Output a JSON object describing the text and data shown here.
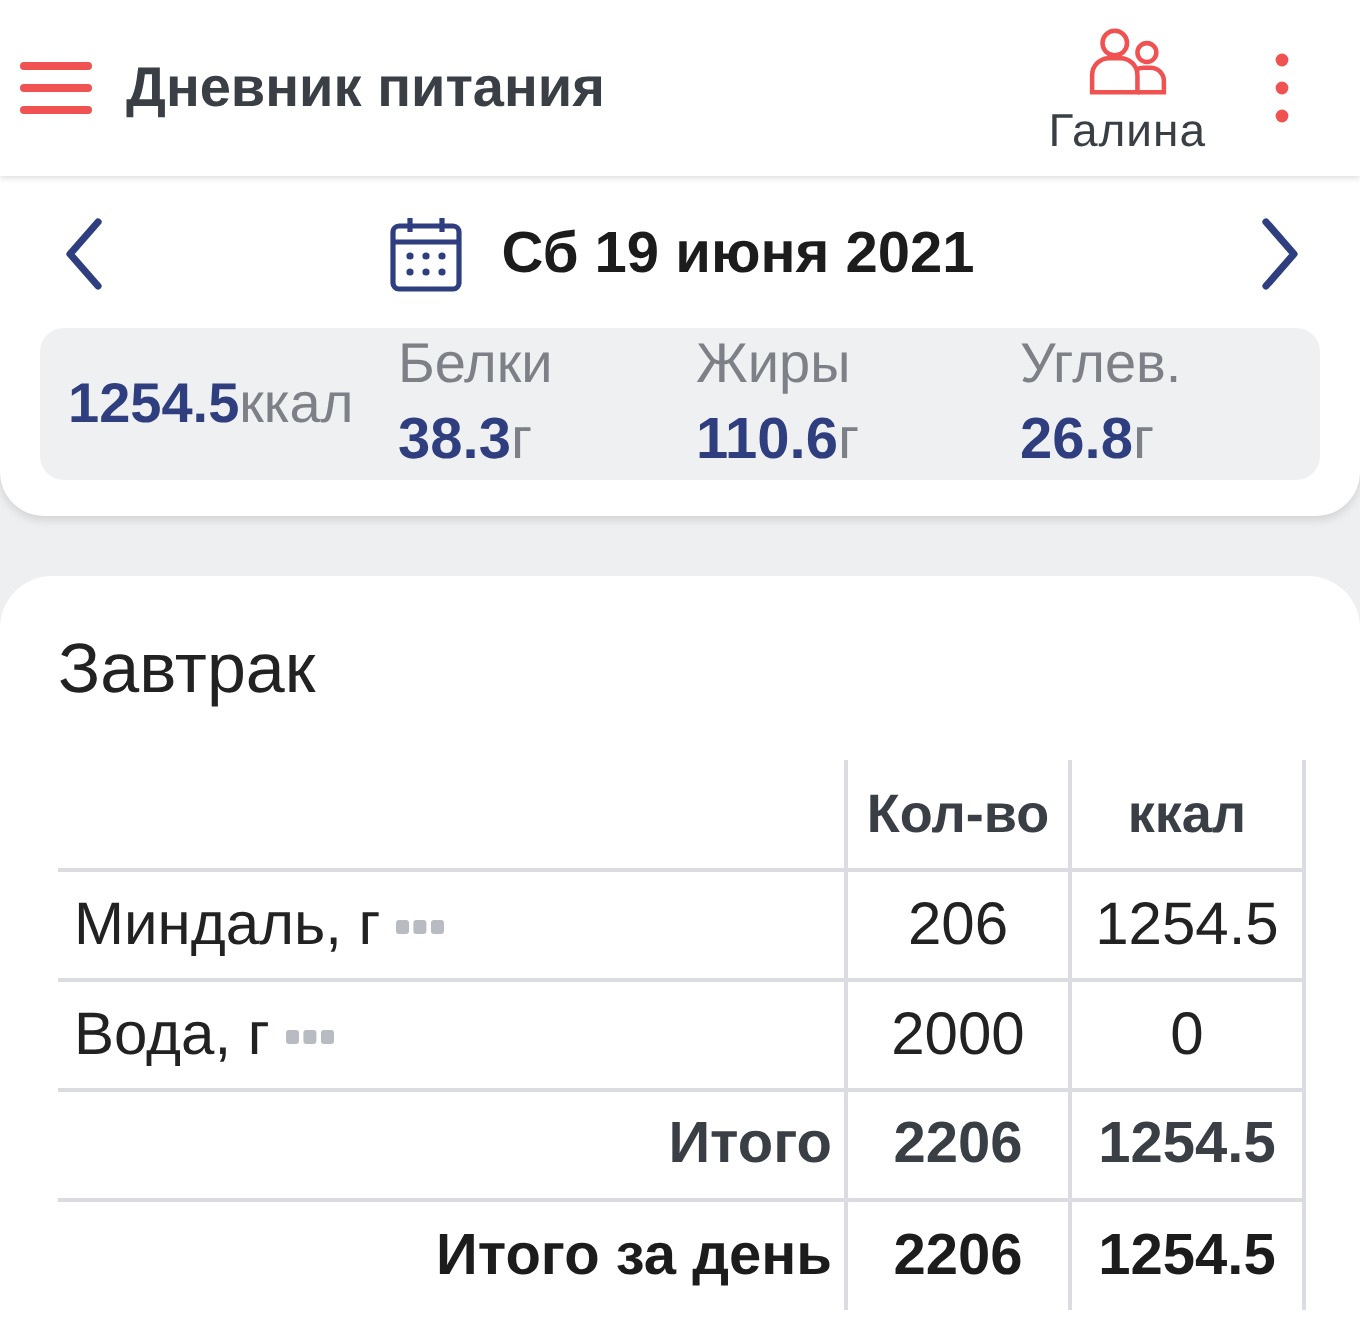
{
  "app_bar": {
    "title": "Дневник питания",
    "profile": {
      "name": "Галина"
    }
  },
  "day": {
    "date": "Сб 19 июня 2021",
    "summary": {
      "calories": {
        "value": "1254.5",
        "unit": "ккал"
      },
      "macros": [
        {
          "label": "Белки",
          "value": "38.3",
          "unit": "г"
        },
        {
          "label": "Жиры",
          "value": "110.6",
          "unit": "г"
        },
        {
          "label": "Углев.",
          "value": "26.8",
          "unit": "г"
        }
      ]
    }
  },
  "meal": {
    "title": "Завтрак",
    "table": {
      "columns": [
        "Кол-во",
        "ккал"
      ],
      "rows": [
        {
          "kind": "item",
          "name": "Миндаль, г",
          "quantity": "206",
          "calories": "1254.5"
        },
        {
          "kind": "item",
          "name": "Вода, г",
          "quantity": "2000",
          "calories": "0"
        },
        {
          "kind": "total",
          "name": "Итого",
          "quantity": "2206",
          "calories": "1254.5"
        },
        {
          "kind": "day_total",
          "name": "Итого за день",
          "quantity": "2206",
          "calories": "1254.5"
        }
      ]
    }
  }
}
